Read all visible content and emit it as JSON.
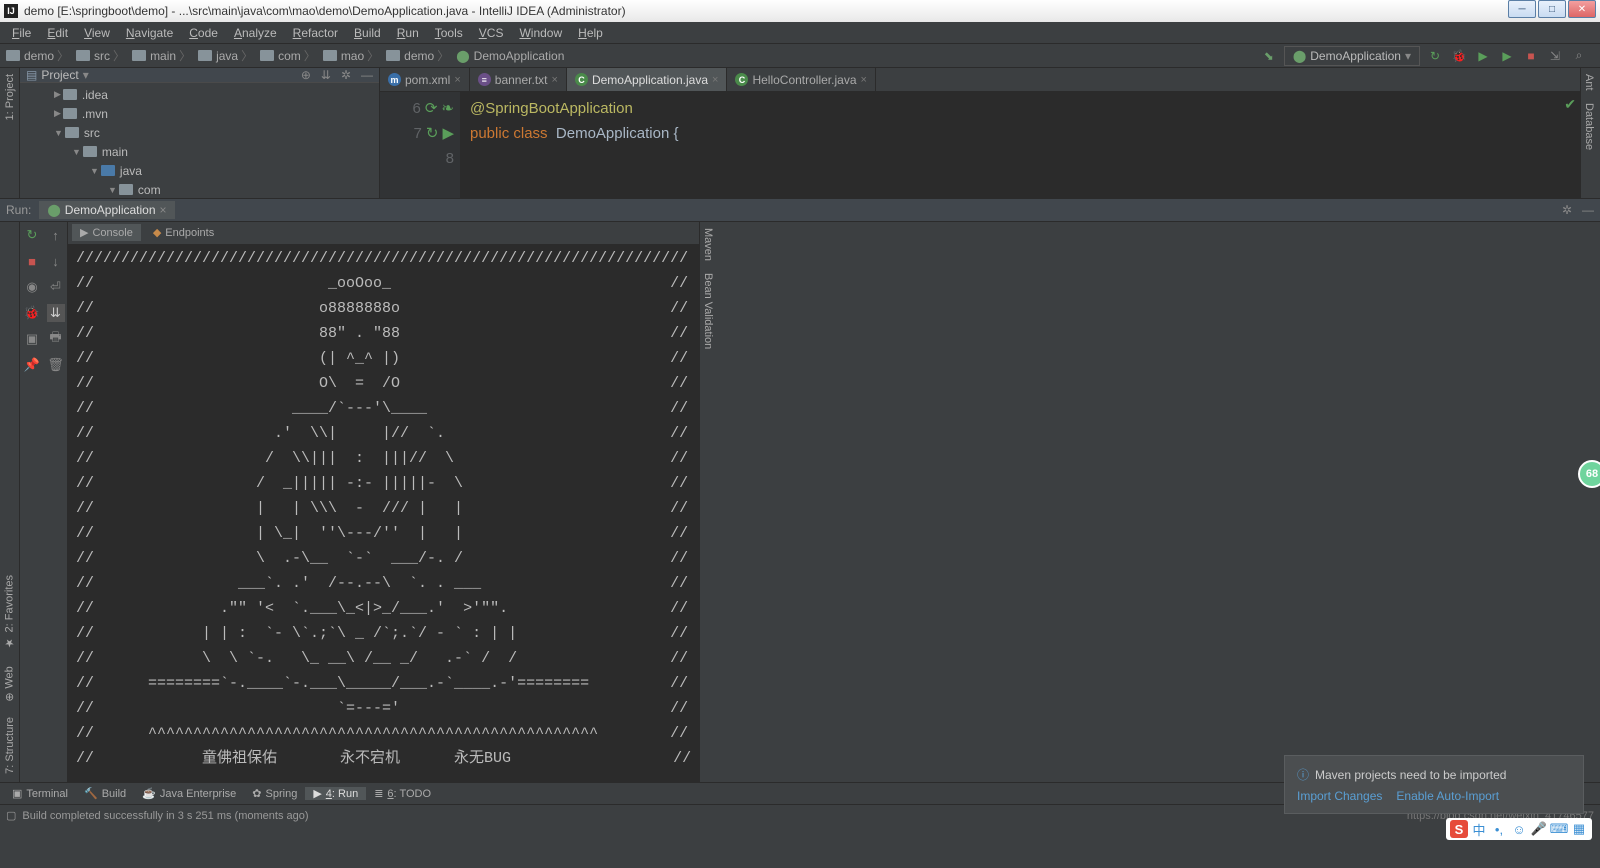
{
  "title": "demo [E:\\springboot\\demo] - ...\\src\\main\\java\\com\\mao\\demo\\DemoApplication.java - IntelliJ IDEA (Administrator)",
  "menu": [
    "File",
    "Edit",
    "View",
    "Navigate",
    "Code",
    "Analyze",
    "Refactor",
    "Build",
    "Run",
    "Tools",
    "VCS",
    "Window",
    "Help"
  ],
  "breadcrumb": [
    "demo",
    "src",
    "main",
    "java",
    "com",
    "mao",
    "demo",
    "DemoApplication"
  ],
  "run_config": "DemoApplication",
  "project": {
    "title": "Project",
    "nodes": [
      {
        "indent": 30,
        "tw": "▶",
        "label": ".idea",
        "cls": ""
      },
      {
        "indent": 30,
        "tw": "▶",
        "label": ".mvn",
        "cls": ""
      },
      {
        "indent": 30,
        "tw": "▼",
        "label": "src",
        "cls": ""
      },
      {
        "indent": 48,
        "tw": "▼",
        "label": "main",
        "cls": ""
      },
      {
        "indent": 66,
        "tw": "▼",
        "label": "java",
        "cls": "blue"
      },
      {
        "indent": 84,
        "tw": "▼",
        "label": "com",
        "cls": ""
      }
    ]
  },
  "editor_tabs": [
    {
      "icon": "m",
      "label": "pom.xml",
      "active": false
    },
    {
      "icon": "txt",
      "label": "banner.txt",
      "active": false
    },
    {
      "icon": "java",
      "label": "DemoApplication.java",
      "active": true
    },
    {
      "icon": "java",
      "label": "HelloController.java",
      "active": false
    }
  ],
  "code": {
    "lines": [
      6,
      7,
      8
    ],
    "l6": "@SpringBootApplication",
    "l7a": "public",
    "l7b": "class",
    "l7c": "  DemoApplication {",
    "l8": ""
  },
  "run": {
    "label": "Run:",
    "tab": "DemoApplication",
    "console_tab": "Console",
    "endpoints_tab": "Endpoints",
    "output": "////////////////////////////////////////////////////////////////////\n//                          _ooOoo_                               //\n//                         o8888888o                              //\n//                         88\" . \"88                              //\n//                         (| ^_^ |)                              //\n//                         O\\  =  /O                              //\n//                      ____/`---'\\____                           //\n//                    .'  \\\\|     |//  `.                         //\n//                   /  \\\\|||  :  |||//  \\                        //\n//                  /  _||||| -:- |||||-  \\                       //\n//                  |   | \\\\\\  -  /// |   |                       //\n//                  | \\_|  ''\\---/''  |   |                       //\n//                  \\  .-\\__  `-`  ___/-. /                       //\n//                ___`. .'  /--.--\\  `. . ___                     //\n//              .\"\" '<  `.___\\_<|>_/___.'  >'\"\".                  //\n//            | | :  `- \\`.;`\\ _ /`;.`/ - ` : | |                 //\n//            \\  \\ `-.   \\_ __\\ /__ _/   .-` /  /                 //\n//      ========`-.____`-.___\\_____/___.-`____.-'========         //\n//                           `=---='                              //\n//      ^^^^^^^^^^^^^^^^^^^^^^^^^^^^^^^^^^^^^^^^^^^^^^^^^^        //\n//            童佛祖保佑       永不宕机      永无BUG                  //"
  },
  "left_tabs": [
    "1: Project"
  ],
  "left_tabs2": [
    "2: Favorites",
    "Web",
    "7: Structure"
  ],
  "right_tabs": [
    "Ant",
    "Database",
    "Maven",
    "Bean Validation"
  ],
  "bottom_tabs": [
    {
      "label": "Terminal",
      "icon": "▣"
    },
    {
      "label": "Build",
      "icon": "🔨"
    },
    {
      "label": "Java Enterprise",
      "icon": "☕"
    },
    {
      "label": "Spring",
      "icon": "✿"
    },
    {
      "label": "4: Run",
      "icon": "▶",
      "active": true
    },
    {
      "label": "6: TODO",
      "icon": "≣"
    }
  ],
  "status": "Build completed successfully in 3 s 251 ms (moments ago)",
  "status_right": "https://blog.csdn.net/weixin_41746577",
  "notif": {
    "title": "Maven projects need to be imported",
    "link1": "Import Changes",
    "link2": "Enable Auto-Import"
  },
  "badge": "68"
}
